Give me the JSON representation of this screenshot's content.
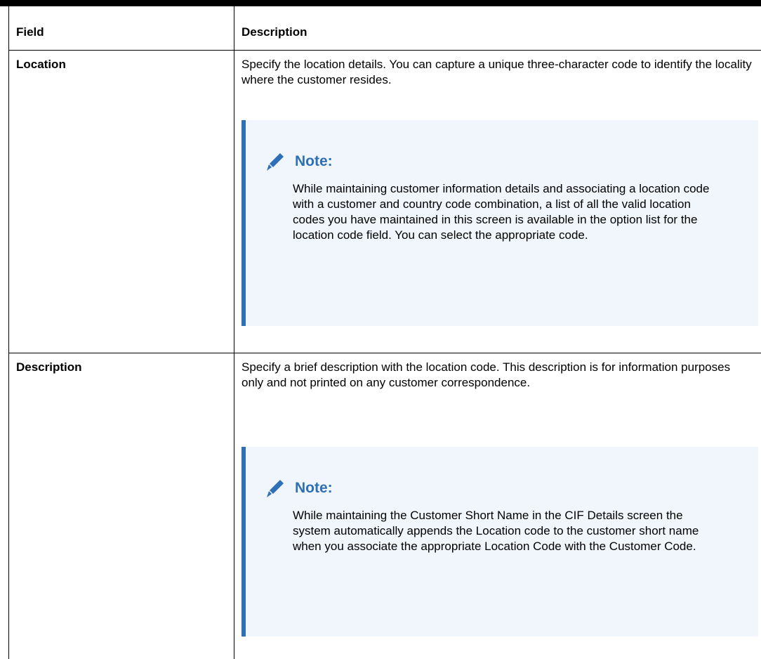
{
  "table": {
    "headers": {
      "field": "Field",
      "description": "Description"
    },
    "rows": [
      {
        "field": "Location",
        "description": "Specify the location details. You can capture a unique three-character code to identify the locality where the customer resides.",
        "note": {
          "title": "Note:",
          "icon": "pencil-icon",
          "text": "While maintaining customer information details and associating a location code with a customer and country code combination, a list of all the valid location codes you have maintained in this screen is available in the option list for the location code field. You can select the appropriate code."
        }
      },
      {
        "field": "Description",
        "description": "Specify a brief description with the location code. This description is for information purposes only and not printed on any customer correspondence.",
        "note": {
          "title": "Note:",
          "icon": "pencil-icon",
          "text": "While maintaining the Customer Short Name in the CIF Details screen the system automatically appends the Location code to the customer short name when you associate the appropriate Location Code with the Customer Code."
        }
      }
    ]
  },
  "colors": {
    "note_accent": "#2e6fb5",
    "note_background": "#f1f6fc"
  }
}
